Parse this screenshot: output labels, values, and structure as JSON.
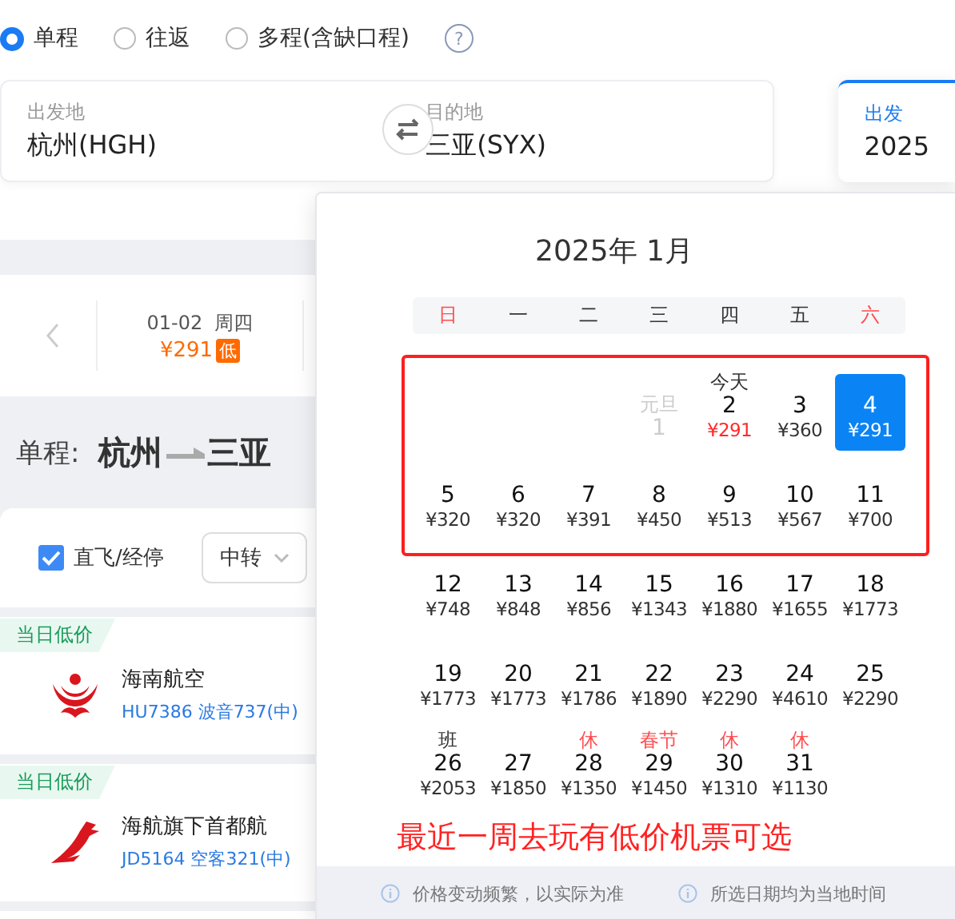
{
  "help": "?",
  "trip_types": [
    {
      "label": "单程",
      "selected": true
    },
    {
      "label": "往返",
      "selected": false
    },
    {
      "label": "多程(含缺口程)",
      "selected": false
    }
  ],
  "search": {
    "origin": {
      "label": "出发地",
      "value": "杭州(HGH)"
    },
    "destination": {
      "label": "目的地",
      "value": "三亚(SYX)"
    },
    "date": {
      "label": "出发",
      "value": "2025"
    }
  },
  "date_tabs": [
    {
      "date": "01-02",
      "weekday": "周四",
      "price": "¥291",
      "badge": "低",
      "selected": true
    }
  ],
  "route": {
    "prefix": "单程:",
    "from": "杭州",
    "to": "三亚"
  },
  "filters": {
    "direct": {
      "label": "直飞/经停",
      "checked": true
    },
    "transfer": {
      "label": "中转"
    }
  },
  "flights": [
    {
      "tag": "当日低价",
      "airline": "海南航空",
      "flight": "HU7386 波音737(中)",
      "kind": "phoenix"
    },
    {
      "tag": "当日低价",
      "airline": "海航旗下首都航",
      "flight": "JD5164 空客321(中)",
      "kind": "dragon"
    }
  ],
  "calendar": {
    "title": "2025年 1月",
    "weekdays": [
      {
        "label": "日",
        "weekend": true
      },
      {
        "label": "一",
        "weekend": false
      },
      {
        "label": "二",
        "weekend": false
      },
      {
        "label": "三",
        "weekend": false
      },
      {
        "label": "四",
        "weekend": false
      },
      {
        "label": "五",
        "weekend": false
      },
      {
        "label": "六",
        "weekend": true
      }
    ],
    "days": [
      {
        "kind": "blank"
      },
      {
        "kind": "blank"
      },
      {
        "kind": "blank"
      },
      {
        "day": "1",
        "note": "元旦",
        "holiday": false,
        "disabled": true,
        "selected": false,
        "low": false
      },
      {
        "day": "2",
        "note": "今天",
        "holiday": false,
        "price": "¥291",
        "disabled": false,
        "selected": false,
        "low": true
      },
      {
        "day": "3",
        "price": "¥360",
        "disabled": false,
        "selected": false,
        "low": false
      },
      {
        "day": "4",
        "price": "¥291",
        "disabled": false,
        "selected": true,
        "low": false
      },
      {
        "day": "5",
        "price": "¥320",
        "disabled": false,
        "selected": false,
        "low": false
      },
      {
        "day": "6",
        "price": "¥320",
        "disabled": false,
        "selected": false,
        "low": false
      },
      {
        "day": "7",
        "price": "¥391",
        "disabled": false,
        "selected": false,
        "low": false
      },
      {
        "day": "8",
        "price": "¥450",
        "disabled": false,
        "selected": false,
        "low": false
      },
      {
        "day": "9",
        "price": "¥513",
        "disabled": false,
        "selected": false,
        "low": false
      },
      {
        "day": "10",
        "price": "¥567",
        "disabled": false,
        "selected": false,
        "low": false
      },
      {
        "day": "11",
        "price": "¥700",
        "disabled": false,
        "selected": false,
        "low": false
      },
      {
        "day": "12",
        "price": "¥748",
        "disabled": false,
        "selected": false,
        "low": false
      },
      {
        "day": "13",
        "price": "¥848",
        "disabled": false,
        "selected": false,
        "low": false
      },
      {
        "day": "14",
        "price": "¥856",
        "disabled": false,
        "selected": false,
        "low": false
      },
      {
        "day": "15",
        "price": "¥1343",
        "disabled": false,
        "selected": false,
        "low": false
      },
      {
        "day": "16",
        "price": "¥1880",
        "disabled": false,
        "selected": false,
        "low": false
      },
      {
        "day": "17",
        "price": "¥1655",
        "disabled": false,
        "selected": false,
        "low": false
      },
      {
        "day": "18",
        "price": "¥1773",
        "disabled": false,
        "selected": false,
        "low": false
      },
      {
        "day": "19",
        "price": "¥1773",
        "disabled": false,
        "selected": false,
        "low": false
      },
      {
        "day": "20",
        "price": "¥1773",
        "disabled": false,
        "selected": false,
        "low": false
      },
      {
        "day": "21",
        "price": "¥1786",
        "disabled": false,
        "selected": false,
        "low": false
      },
      {
        "day": "22",
        "price": "¥1890",
        "disabled": false,
        "selected": false,
        "low": false
      },
      {
        "day": "23",
        "price": "¥2290",
        "disabled": false,
        "selected": false,
        "low": false
      },
      {
        "day": "24",
        "price": "¥4610",
        "disabled": false,
        "selected": false,
        "low": false
      },
      {
        "day": "25",
        "price": "¥2290",
        "disabled": false,
        "selected": false,
        "low": false
      },
      {
        "day": "26",
        "note": "班",
        "holiday": false,
        "price": "¥2053",
        "disabled": false,
        "selected": false,
        "low": false
      },
      {
        "day": "27",
        "price": "¥1850",
        "disabled": false,
        "selected": false,
        "low": false
      },
      {
        "day": "28",
        "note": "休",
        "holiday": true,
        "price": "¥1350",
        "disabled": false,
        "selected": false,
        "low": false
      },
      {
        "day": "29",
        "note": "春节",
        "holiday": true,
        "price": "¥1450",
        "disabled": false,
        "selected": false,
        "low": false
      },
      {
        "day": "30",
        "note": "休",
        "holiday": true,
        "price": "¥1310",
        "disabled": false,
        "selected": false,
        "low": false
      },
      {
        "day": "31",
        "note": "休",
        "holiday": true,
        "price": "¥1130",
        "disabled": false,
        "selected": false,
        "low": false
      }
    ],
    "footer": [
      "价格变动频繁，以实际为准",
      "所选日期均为当地时间"
    ]
  },
  "annotation": {
    "text": "最近一周去玩有低价机票可选"
  }
}
